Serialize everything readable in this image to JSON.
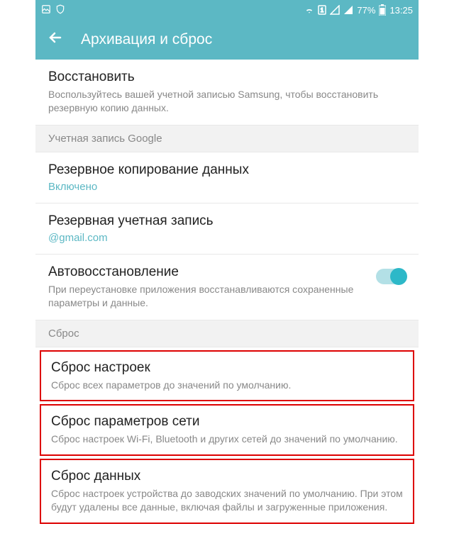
{
  "statusBar": {
    "battery": "77%",
    "time": "13:25"
  },
  "header": {
    "title": "Архивация и сброс"
  },
  "restore": {
    "title": "Восстановить",
    "desc": "Воспользуйтесь вашей учетной записью Samsung, чтобы восстановить резервную копию данных."
  },
  "googleAccount": {
    "header": "Учетная запись Google"
  },
  "backup": {
    "title": "Резервное копирование данных",
    "value": "Включено"
  },
  "backupAccount": {
    "title": "Резервная учетная запись",
    "value": "@gmail.com"
  },
  "autoRestore": {
    "title": "Автовосстановление",
    "desc": "При переустановке приложения восстанавливаются сохраненные параметры и данные."
  },
  "resetHeader": {
    "label": "Сброс"
  },
  "resetSettings": {
    "title": "Сброс настроек",
    "desc": "Сброс всех параметров до значений по умолчанию."
  },
  "resetNetwork": {
    "title": "Сброс параметров сети",
    "desc": "Сброс настроек Wi-Fi, Bluetooth и других сетей до значений по умолчанию."
  },
  "resetData": {
    "title": "Сброс данных",
    "desc": "Сброс настроек устройства до заводских значений по умолчанию. При этом будут удалены все данные, включая файлы и загруженные приложения."
  }
}
